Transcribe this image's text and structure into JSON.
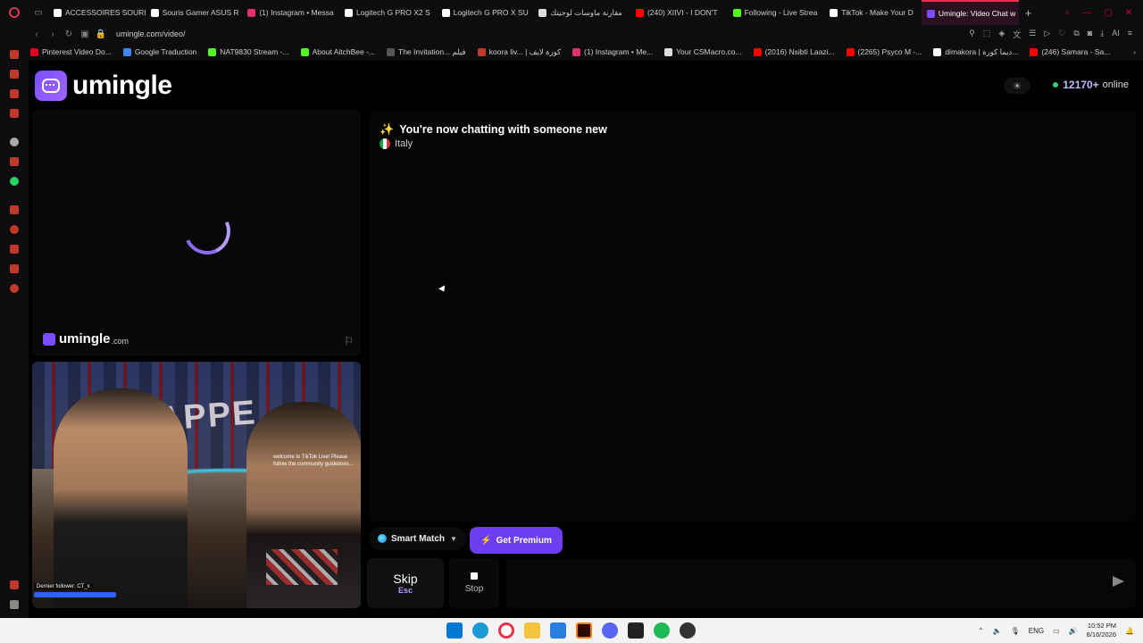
{
  "browser": {
    "tabs": [
      {
        "label": "ACCESSOIRES SOURI",
        "color": "#ffffff"
      },
      {
        "label": "Souris Gamer ASUS R",
        "color": "#ffffff"
      },
      {
        "label": "(1) Instagram • Messa",
        "color": "#e1306c"
      },
      {
        "label": "Logitech G PRO X2 S",
        "color": "#ffffff"
      },
      {
        "label": "Logitech G PRO X SU",
        "color": "#ffffff"
      },
      {
        "label": "مقارنة ماوسات لوجيتك",
        "color": "#dddddd"
      },
      {
        "label": "(240) XIIVI - I DON'T",
        "color": "#ff0000"
      },
      {
        "label": "Following - Live Strea",
        "color": "#53fc18"
      },
      {
        "label": "TikTok - Make Your D",
        "color": "#ffffff"
      },
      {
        "label": "Umingle: Video Chat w",
        "color": "#7b4dff",
        "active": true
      }
    ],
    "new_tab_label": "+",
    "url": "umingle.com/video/",
    "bookmarks": [
      {
        "label": "Pinterest Video Do...",
        "color": "#e60023"
      },
      {
        "label": "Google Traduction",
        "color": "#4285f4"
      },
      {
        "label": "NAT9830 Stream -...",
        "color": "#53fc18"
      },
      {
        "label": "About AitchBee -...",
        "color": "#53fc18"
      },
      {
        "label": "The Invitation... فيلم",
        "color": "#555555"
      },
      {
        "label": "koora liv... | كورة لايف",
        "color": "#c0392b"
      },
      {
        "label": "(1) Instagram • Me...",
        "color": "#e1306c"
      },
      {
        "label": "Your CSMacro.co...",
        "color": "#dddddd"
      },
      {
        "label": "(2016) Nsibti Laazi...",
        "color": "#ff0000"
      },
      {
        "label": "(2265) Psyco M -...",
        "color": "#ff0000"
      },
      {
        "label": "dimakora | ديما كورة...",
        "color": "#ffffff"
      },
      {
        "label": "(246) Samara - Sa...",
        "color": "#ff0000"
      }
    ]
  },
  "site": {
    "logo_text": "umingle",
    "online_count": "12170+",
    "online_label": "online",
    "watermark_name": "umingle",
    "watermark_domain": ".com",
    "chat_status": "You're now chatting with someone new",
    "country": "Italy",
    "smart_match_label": "Smart Match",
    "premium_label": "Get Premium",
    "skip_label": "Skip",
    "skip_key": "Esc",
    "stop_label": "Stop",
    "message_placeholder": "",
    "camera_overlay_text": "welcome to TikTok Live! Please follow the community guidelines...",
    "camera_follower_text": "Dernier follower: CT_x",
    "accent_color": "#6d3df2"
  },
  "taskbar": {
    "language": "ENG",
    "time": "10:52 PM",
    "date": "8/16/2026"
  }
}
